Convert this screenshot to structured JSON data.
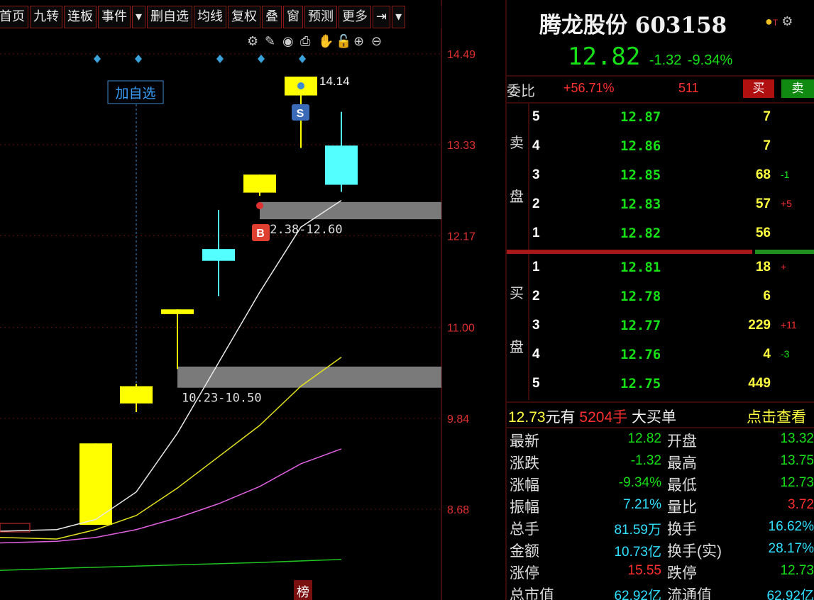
{
  "toolbar": {
    "items": [
      "首页",
      "九转",
      "连板",
      "事件",
      "▾",
      "删自选",
      "均线",
      "复权",
      "叠",
      "窗",
      "预测",
      "更多",
      "⇥",
      "▾"
    ]
  },
  "chart": {
    "tools": [
      "settings-icon",
      "pen-icon",
      "eye-icon",
      "print-icon",
      "hand-icon",
      "lock-icon",
      "zoom-in-icon",
      "zoom-out-icon"
    ],
    "price_labels": [
      "14.49",
      "13.33",
      "12.17",
      "11.00",
      "9.84",
      "8.68"
    ],
    "high_label": "14.14",
    "add_watch_label": "加自选",
    "sell_marker": "S",
    "buy_marker": "B",
    "gap_upper_label": "12.38-12.60",
    "gap_lower_label": "10.23-10.50",
    "list_badge": "榜",
    "colors": {
      "up": "#ffff00",
      "down": "#54ffff",
      "gap": "#7a7a7a",
      "ma5": "#e8e8e8",
      "ma10": "#e0e020",
      "ma20": "#e060e0",
      "ma60": "#20c020",
      "axis": "#e03030"
    }
  },
  "quote": {
    "title": "腾龙股份 603158",
    "last_price": "12.82",
    "change": "-1.32",
    "change_pct": "-9.34%",
    "weibi_label": "委比",
    "weibi_pct": "+56.71%",
    "weibi_diff": "511",
    "buy_label": "买",
    "sell_label": "卖",
    "sell_side_label_top": "卖",
    "sell_side_label_bottom": "盘",
    "buy_side_label_top": "买",
    "buy_side_label_bottom": "盘",
    "sell_book": [
      {
        "level": "5",
        "price": "12.87",
        "vol": "7",
        "chg": ""
      },
      {
        "level": "4",
        "price": "12.86",
        "vol": "7",
        "chg": ""
      },
      {
        "level": "3",
        "price": "12.85",
        "vol": "68",
        "chg": "-1"
      },
      {
        "level": "2",
        "price": "12.83",
        "vol": "57",
        "chg": "+5"
      },
      {
        "level": "1",
        "price": "12.82",
        "vol": "56",
        "chg": ""
      }
    ],
    "buy_book": [
      {
        "level": "1",
        "price": "12.81",
        "vol": "18",
        "chg": "+"
      },
      {
        "level": "2",
        "price": "12.78",
        "vol": "6",
        "chg": ""
      },
      {
        "level": "3",
        "price": "12.77",
        "vol": "229",
        "chg": "+11"
      },
      {
        "level": "4",
        "price": "12.76",
        "vol": "4",
        "chg": "-3"
      },
      {
        "level": "5",
        "price": "12.75",
        "vol": "449",
        "chg": ""
      }
    ],
    "big_order": {
      "price": "12.73",
      "unit_text": "元有",
      "qty": "5204",
      "qty_unit": "手",
      "desc": "大买单",
      "link": "点击查看"
    },
    "stats": [
      {
        "l1": "最新",
        "v1": "12.82",
        "c1": "green",
        "l2": "开盘",
        "v2": "13.32",
        "c2": "green"
      },
      {
        "l1": "涨跌",
        "v1": "-1.32",
        "c1": "green",
        "l2": "最高",
        "v2": "13.75",
        "c2": "green"
      },
      {
        "l1": "涨幅",
        "v1": "-9.34%",
        "c1": "green",
        "l2": "最低",
        "v2": "12.73",
        "c2": "green"
      },
      {
        "l1": "振幅",
        "v1": "7.21%",
        "c1": "cyan",
        "l2": "量比",
        "v2": "3.72",
        "c2": "red"
      },
      {
        "l1": "总手",
        "v1": "81.59万",
        "c1": "cyan",
        "l2": "换手",
        "v2": "16.62%",
        "c2": "cyan"
      },
      {
        "l1": "金额",
        "v1": "10.73亿",
        "c1": "cyan",
        "l2": "换手(实)",
        "v2": "28.17%",
        "c2": "cyan"
      },
      {
        "l1": "涨停",
        "v1": "15.55",
        "c1": "red",
        "l2": "跌停",
        "v2": "12.73",
        "c2": "green"
      },
      {
        "l1": "总市值",
        "v1": "62.92亿",
        "c1": "cyan",
        "l2": "流通值",
        "v2": "62.92亿",
        "c2": "cyan"
      }
    ]
  }
}
